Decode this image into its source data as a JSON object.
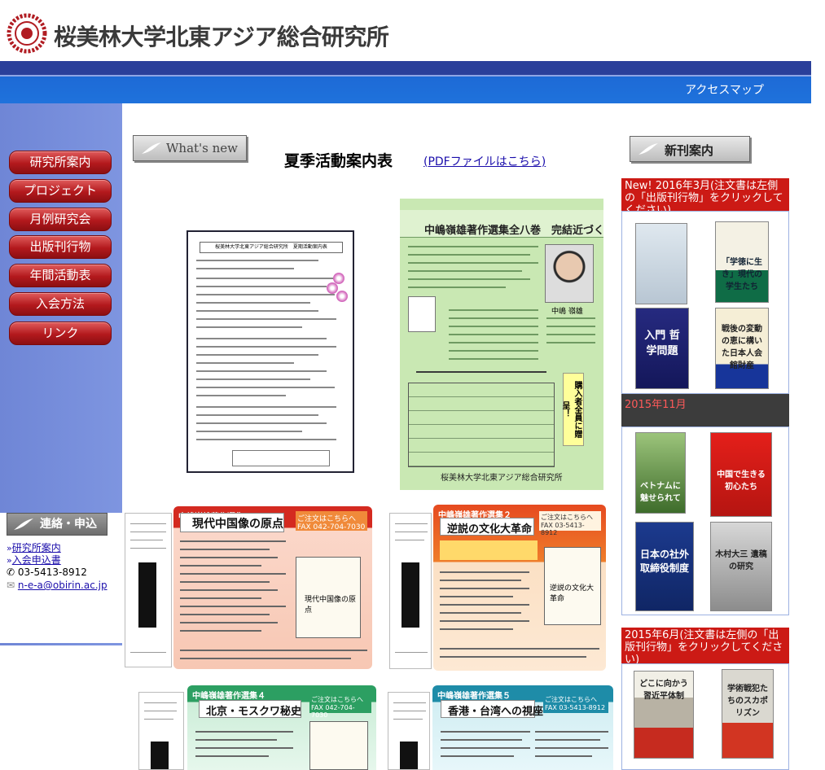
{
  "header": {
    "title": "桜美林大学北東アジア総合研究所",
    "access_map": "アクセスマップ"
  },
  "nav": {
    "items": [
      {
        "label": "研究所案内"
      },
      {
        "label": "プロジェクト"
      },
      {
        "label": "月例研究会"
      },
      {
        "label": "出版刊行物"
      },
      {
        "label": "年間活動表"
      },
      {
        "label": "入会方法"
      },
      {
        "label": "リンク"
      }
    ]
  },
  "contact": {
    "heading": "連絡・申込先",
    "link1": "研究所案内",
    "link2": "入会申込書",
    "phone": "03-5413-8912",
    "email": "n-e-a@obirin.ac.jp"
  },
  "main": {
    "whats_new_label": "What's new",
    "summer_title": "夏季活動案内表",
    "summer_link": "(PDFファイルはこちら)",
    "flyer_heading": "桜美林大学北東アジア総合研究所　夏期活動案内表",
    "poster_title": "中嶋嶺雄著作選集全八巻　完結近づく！",
    "poster_name": "中嶋 嶺雄",
    "poster_vertical": "購入者全員に贈呈！",
    "poster_footer": "桜美林大学北東アジア総合研究所",
    "sheets": [
      {
        "series": "中嶋嶺雄著作選集１",
        "title": "現代中国像の原点"
      },
      {
        "series": "中嶋嶺雄著作選集２",
        "title": "逆説の文化大革命"
      },
      {
        "series": "中嶋嶺雄著作選集４",
        "title": "北京・モスクワ秘史"
      },
      {
        "series": "中嶋嶺雄著作選集５",
        "title": "香港・台湾への視座"
      }
    ],
    "order_label": "ご注文はこちらへ",
    "fax1": "FAX 042-704-7030",
    "fax2": "FAX 03-5413-8912"
  },
  "shinkan": {
    "tab_label": "新刊案内",
    "head1": "New! 2016年3月(注文書は左側の「出版刊行物」をクリックしてください)",
    "head2": "2015年11月",
    "head3": "2015年6月(注文書は左側の「出版刊行物」をクリックしてください)",
    "books1": [
      "",
      "「学徳に生き」現代の学生たち",
      "入門 哲学問題",
      "戦後の変動の恵に構いた日本人会館財産"
    ],
    "books2": [
      "ベトナムに魅せられて",
      "中国で生きる初心たち",
      "日本の社外取締役制度",
      "木村大三 遺稿の研究"
    ],
    "books3": [
      "どこに向かう 習近平体制",
      "学術戦犯たちのスカポリズン"
    ]
  },
  "colors": {
    "nav_red": "#b3191d",
    "sidebar_blue": "#7e95e0",
    "header_blue": "#1f72dc",
    "category_red": "#cc1a15"
  }
}
